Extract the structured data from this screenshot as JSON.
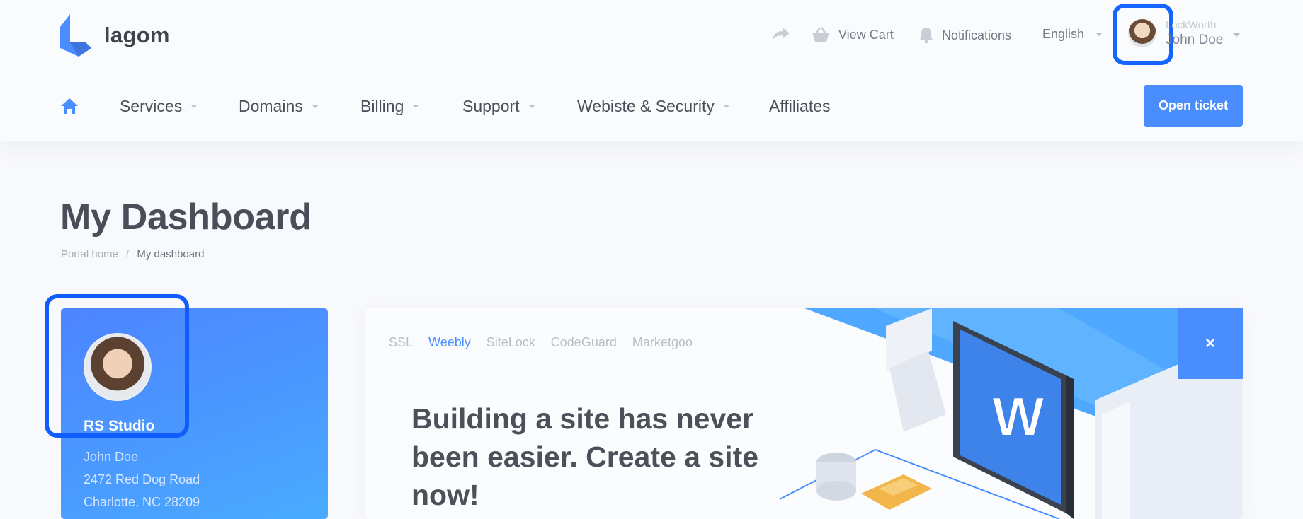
{
  "header": {
    "logo_text": "lagom",
    "share_icon": "share-arrow-icon",
    "view_cart": "View Cart",
    "notifications": "Notifications",
    "language": "English",
    "user_company": "LockWorth",
    "user_name": "John Doe"
  },
  "nav": {
    "items": [
      {
        "label": "Services"
      },
      {
        "label": "Domains"
      },
      {
        "label": "Billing"
      },
      {
        "label": "Support"
      },
      {
        "label": "Webiste & Security"
      },
      {
        "label": "Affiliates"
      }
    ],
    "open_ticket": "Open ticket"
  },
  "page": {
    "title": "My Dashboard",
    "breadcrumb_home": "Portal home",
    "breadcrumb_sep": "/",
    "breadcrumb_current": "My dashboard"
  },
  "profile": {
    "company": "RS Studio",
    "name": "John Doe",
    "address_line1": "2472 Red Dog Road",
    "address_line2": "Charlotte, NC 28209"
  },
  "promo": {
    "tabs": [
      "SSL",
      "Weebly",
      "SiteLock",
      "CodeGuard",
      "Marketgoo"
    ],
    "active_tab": "Weebly",
    "headline": "Building a site has never been easier. Create a site now!",
    "close_label": "×",
    "weebly_logo_letter": "W"
  },
  "colors": {
    "accent": "#4a8dff",
    "highlight": "#1566ff"
  }
}
